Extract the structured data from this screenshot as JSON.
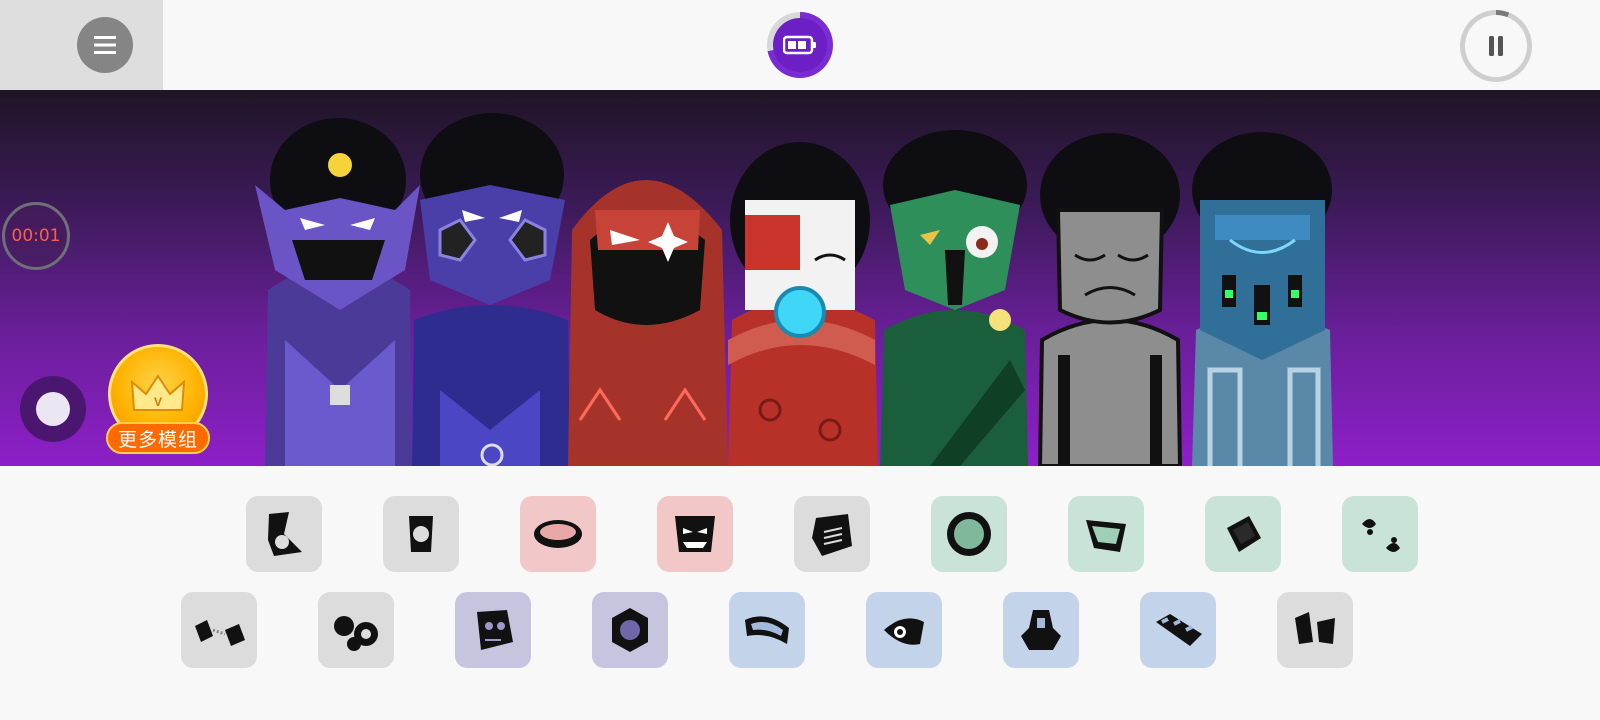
{
  "topbar": {
    "menu_icon": "hamburger-icon",
    "battery_icon": "battery-icon",
    "pause_icon": "pause-icon"
  },
  "stage": {
    "timer": "00:01",
    "record_icon": "record-icon",
    "more_mods_label": "更多模组",
    "crown_icon": "crown-icon",
    "characters": [
      {
        "name": "purple-skull-mask",
        "color": "#5b48b8"
      },
      {
        "name": "blue-horned-mask",
        "color": "#3b3aa6"
      },
      {
        "name": "red-hooded",
        "color": "#c2392f"
      },
      {
        "name": "red-visor-cyborg",
        "color": "#b83228"
      },
      {
        "name": "green-tribal",
        "color": "#1f7a4a"
      },
      {
        "name": "gray-shirtless",
        "color": "#8c8c8c"
      },
      {
        "name": "blue-robot-mask",
        "color": "#3b7fa8"
      }
    ]
  },
  "palette": {
    "row1": [
      {
        "icon": "beats-1-icon",
        "tone": "gray"
      },
      {
        "icon": "beats-2-icon",
        "tone": "gray"
      },
      {
        "icon": "effects-1-icon",
        "tone": "red"
      },
      {
        "icon": "effects-2-icon",
        "tone": "red"
      },
      {
        "icon": "effects-3-icon",
        "tone": "gray"
      },
      {
        "icon": "melody-1-icon",
        "tone": "green"
      },
      {
        "icon": "melody-2-icon",
        "tone": "green"
      },
      {
        "icon": "melody-3-icon",
        "tone": "green"
      },
      {
        "icon": "melody-4-icon",
        "tone": "green"
      }
    ],
    "row2": [
      {
        "icon": "beats-3-icon",
        "tone": "gray"
      },
      {
        "icon": "beats-4-icon",
        "tone": "gray"
      },
      {
        "icon": "effects-4-icon",
        "tone": "purple"
      },
      {
        "icon": "effects-5-icon",
        "tone": "purple"
      },
      {
        "icon": "voice-1-icon",
        "tone": "blue"
      },
      {
        "icon": "voice-2-icon",
        "tone": "blue"
      },
      {
        "icon": "voice-3-icon",
        "tone": "blue"
      },
      {
        "icon": "voice-4-icon",
        "tone": "blue"
      },
      {
        "icon": "voice-5-icon",
        "tone": "gray"
      }
    ]
  }
}
